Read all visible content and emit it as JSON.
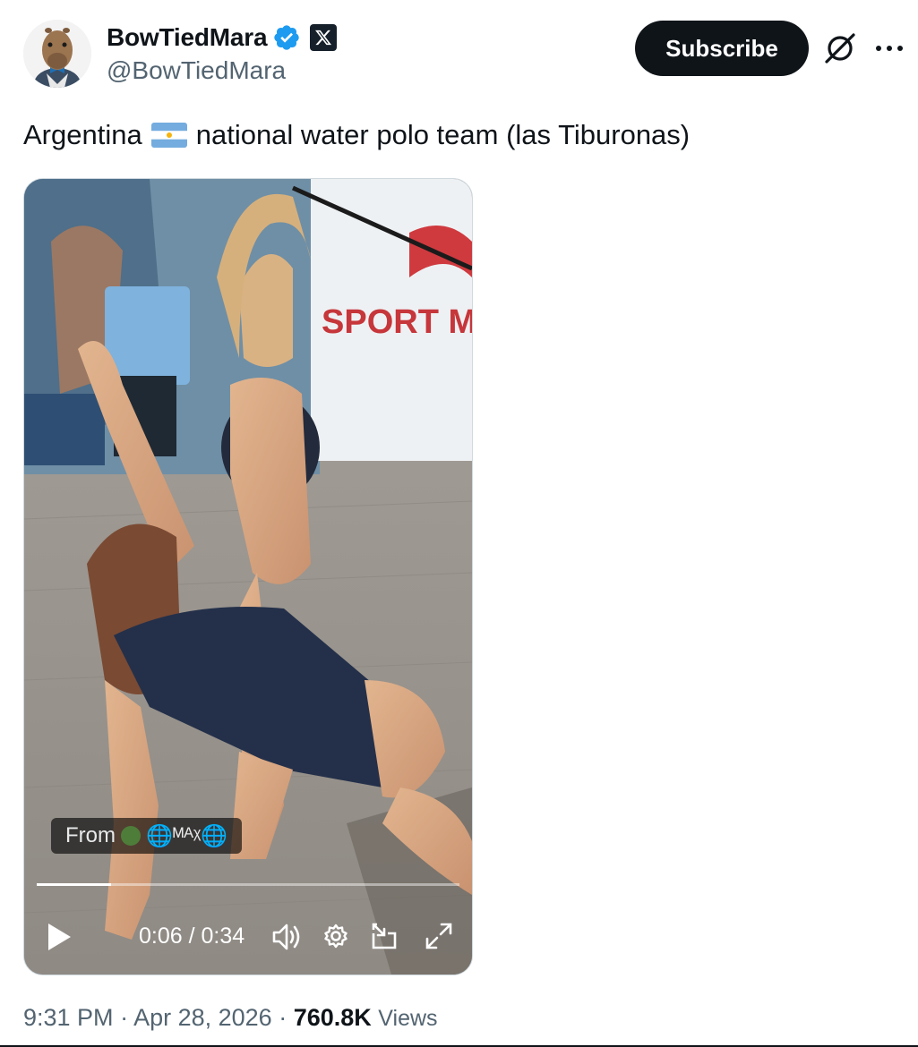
{
  "author": {
    "display_name": "BowTiedMara",
    "handle": "@BowTiedMara",
    "verified": true,
    "avatar_icon": "capybara-bowtie-avatar",
    "affiliation_icon": "x-logo-icon"
  },
  "actions": {
    "subscribe_label": "Subscribe",
    "grok_icon": "grok-icon",
    "more_icon": "more-icon"
  },
  "tweet": {
    "text_before": "Argentina",
    "flag": "argentina-flag",
    "text_after": "national water polo team (las Tiburonas)"
  },
  "media": {
    "attribution_prefix": "From",
    "attribution_name": "🌐ᴹᴬᵡ🌐",
    "current_time": "0:06",
    "time_separator": " / ",
    "duration": "0:34",
    "progress_fraction": 0.176,
    "wall_sign_text": "SPORT M",
    "controls": [
      "play-icon",
      "volume-icon",
      "settings-icon",
      "pip-icon",
      "fullscreen-icon"
    ]
  },
  "meta": {
    "time": "9:31 PM",
    "separator": " · ",
    "date": "Apr 28, 2026",
    "views_count": "760.8K",
    "views_label": "Views"
  },
  "colors": {
    "text_primary": "#0f1419",
    "text_secondary": "#536471",
    "verified_blue": "#1d9bf0",
    "button_bg": "#0f1419"
  }
}
